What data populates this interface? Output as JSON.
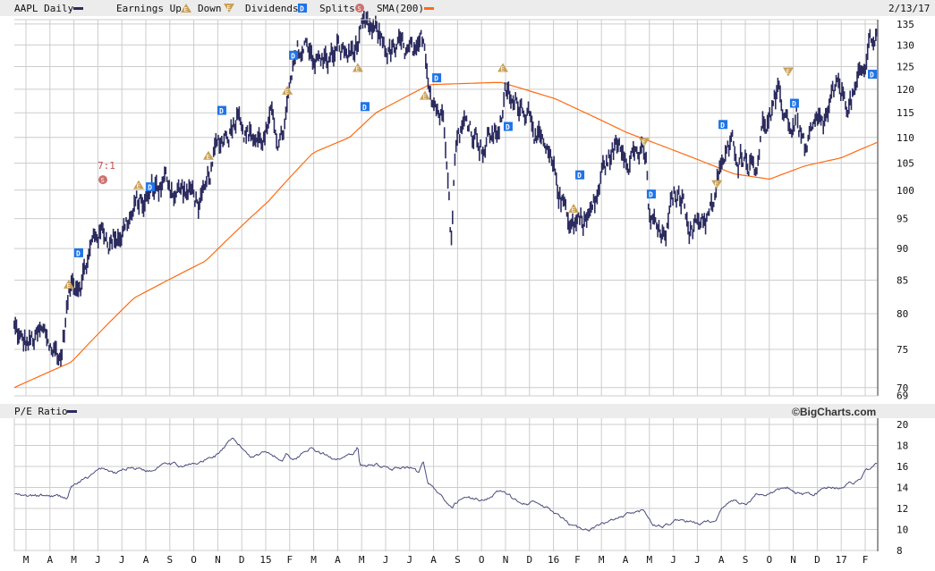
{
  "header": {
    "symbol_label": "AAPL Daily",
    "earnings_label": "Earnings Up",
    "down_label": "Down",
    "dividends_label": "Dividends",
    "splits_label": "Splits",
    "sma_label": "SMA(200)",
    "date": "2/13/17"
  },
  "lower_header": {
    "label": "P/E Ratio",
    "brand": "©BigCharts.com"
  },
  "colors": {
    "price": "#2b2b5e",
    "sma": "#ff6a10",
    "grid": "#cccccc",
    "header_bg": "#ececec",
    "earnings": "#c9a055",
    "dividend": "#1e73e8",
    "split": "#d07070"
  },
  "icons": {
    "earnings_up": "E",
    "earnings_down": "E",
    "dividend": "D",
    "split": "S"
  },
  "chart_data": [
    {
      "type": "line",
      "title": "AAPL Daily",
      "x_unit": "months since 2014-03-01",
      "scale": "log",
      "ylim": [
        69,
        135
      ],
      "yticks": [
        135,
        130,
        125,
        120,
        115,
        110,
        105,
        100,
        95,
        90,
        85,
        80,
        75,
        70,
        69
      ],
      "price": [
        [
          -0.49,
          78
        ],
        [
          -0.15,
          75
        ],
        [
          0.6,
          76
        ],
        [
          1.46,
          74
        ],
        [
          1.75,
          82
        ],
        [
          1.9,
          84
        ],
        [
          2.46,
          88
        ],
        [
          3.02,
          93
        ],
        [
          3.58,
          92
        ],
        [
          4.14,
          95
        ],
        [
          5.07,
          98
        ],
        [
          5.45,
          101
        ],
        [
          6.19,
          101
        ],
        [
          6.94,
          99
        ],
        [
          7.5,
          97
        ],
        [
          7.87,
          105
        ],
        [
          8.54,
          113
        ],
        [
          8.92,
          119
        ],
        [
          9.18,
          113
        ],
        [
          9.74,
          110
        ],
        [
          10.3,
          112
        ],
        [
          10.67,
          109
        ],
        [
          11.04,
          119
        ],
        [
          11.31,
          125
        ],
        [
          11.79,
          130
        ],
        [
          12.35,
          126
        ],
        [
          12.91,
          128
        ],
        [
          13.47,
          127
        ],
        [
          13.92,
          131
        ],
        [
          14.59,
          130
        ],
        [
          15.34,
          128
        ],
        [
          16.08,
          126
        ],
        [
          16.31,
          123
        ],
        [
          16.57,
          128
        ],
        [
          16.83,
          122
        ],
        [
          17.39,
          115
        ],
        [
          17.65,
          105
        ],
        [
          17.72,
          93
        ],
        [
          17.95,
          113
        ],
        [
          18.51,
          113
        ],
        [
          19.07,
          110
        ],
        [
          19.63,
          111
        ],
        [
          20.0,
          119
        ],
        [
          20.37,
          115
        ],
        [
          20.75,
          118
        ],
        [
          21.12,
          117
        ],
        [
          21.49,
          108
        ],
        [
          22.05,
          100
        ],
        [
          22.43,
          97
        ],
        [
          22.8,
          95
        ],
        [
          23.36,
          96
        ],
        [
          23.73,
          97
        ],
        [
          24.1,
          104
        ],
        [
          24.66,
          108
        ],
        [
          25.22,
          110
        ],
        [
          25.6,
          108
        ],
        [
          25.86,
          104
        ],
        [
          25.97,
          95
        ],
        [
          26.34,
          92
        ],
        [
          26.53,
          90
        ],
        [
          27.09,
          98
        ],
        [
          27.46,
          98
        ],
        [
          27.84,
          94
        ],
        [
          28.21,
          96
        ],
        [
          28.77,
          97
        ],
        [
          28.96,
          104
        ],
        [
          29.51,
          107
        ],
        [
          30.07,
          108
        ],
        [
          30.45,
          106
        ],
        [
          30.63,
          113
        ],
        [
          31.38,
          116
        ],
        [
          31.94,
          112
        ],
        [
          32.13,
          115
        ],
        [
          32.5,
          107
        ],
        [
          32.87,
          109
        ],
        [
          33.25,
          110
        ],
        [
          33.62,
          116
        ],
        [
          34.18,
          117
        ],
        [
          34.74,
          120
        ],
        [
          35.0,
          121
        ],
        [
          35.11,
          128
        ],
        [
          35.3,
          132
        ],
        [
          35.49,
          134
        ]
      ],
      "sma200": [
        [
          -0.49,
          70
        ],
        [
          1.9,
          73.3
        ],
        [
          4.51,
          82.3
        ],
        [
          7.5,
          88
        ],
        [
          10.11,
          98
        ],
        [
          11.98,
          107
        ],
        [
          13.5,
          110
        ],
        [
          14.59,
          115
        ],
        [
          16.83,
          121
        ],
        [
          19.81,
          121.5
        ],
        [
          22.05,
          118
        ],
        [
          25.04,
          111
        ],
        [
          27.28,
          107
        ],
        [
          29.51,
          103
        ],
        [
          31.01,
          102
        ],
        [
          32.5,
          104.5
        ],
        [
          33.99,
          106
        ],
        [
          35.49,
          109
        ]
      ],
      "events": [
        {
          "type": "earnings_up",
          "t": 1.79,
          "price": 84.4
        },
        {
          "type": "earnings_up",
          "t": 4.7,
          "price": 101
        },
        {
          "type": "earnings_up",
          "t": 7.61,
          "price": 106.5
        },
        {
          "type": "earnings_up",
          "t": 10.9,
          "price": 119.8
        },
        {
          "type": "earnings_up",
          "t": 13.84,
          "price": 124.8
        },
        {
          "type": "earnings_up",
          "t": 16.64,
          "price": 118.7
        },
        {
          "type": "earnings_up",
          "t": 19.89,
          "price": 124.8
        },
        {
          "type": "earnings_up",
          "t": 22.84,
          "price": 96.8
        },
        {
          "type": "earnings_down",
          "t": 25.78,
          "price": 109
        },
        {
          "type": "earnings_down",
          "t": 28.81,
          "price": 101
        },
        {
          "type": "earnings_down",
          "t": 31.79,
          "price": 123.8
        },
        {
          "type": "dividend",
          "t": 2.2,
          "price": 89.3
        },
        {
          "type": "dividend",
          "t": 5.19,
          "price": 100.6
        },
        {
          "type": "dividend",
          "t": 8.17,
          "price": 115.5
        },
        {
          "type": "dividend",
          "t": 11.16,
          "price": 127.6
        },
        {
          "type": "dividend",
          "t": 14.14,
          "price": 116.3
        },
        {
          "type": "dividend",
          "t": 17.13,
          "price": 122.5
        },
        {
          "type": "dividend",
          "t": 20.11,
          "price": 112.2
        },
        {
          "type": "dividend",
          "t": 23.1,
          "price": 102.8
        },
        {
          "type": "dividend",
          "t": 26.08,
          "price": 99.3
        },
        {
          "type": "dividend",
          "t": 29.07,
          "price": 112.6
        },
        {
          "type": "dividend",
          "t": 32.05,
          "price": 117
        },
        {
          "type": "dividend",
          "t": 35.3,
          "price": 123.3
        },
        {
          "type": "split",
          "t": 3.21,
          "price": 101.9,
          "label": "7:1"
        }
      ]
    },
    {
      "type": "line",
      "title": "P/E Ratio",
      "ylim": [
        8,
        20
      ],
      "yticks": [
        20,
        18,
        16,
        14,
        12,
        10,
        8
      ],
      "pe": [
        [
          -0.49,
          13.4
        ],
        [
          -0.07,
          13.1
        ],
        [
          1.16,
          13.2
        ],
        [
          1.72,
          13
        ],
        [
          1.9,
          14.1
        ],
        [
          2.65,
          15
        ],
        [
          3.21,
          15.8
        ],
        [
          3.77,
          15.3
        ],
        [
          4.33,
          16
        ],
        [
          5.26,
          15.6
        ],
        [
          5.82,
          16.6
        ],
        [
          6.38,
          16.1
        ],
        [
          7.13,
          16.2
        ],
        [
          7.87,
          17
        ],
        [
          8.62,
          18.5
        ],
        [
          9.37,
          17
        ],
        [
          10.11,
          17.5
        ],
        [
          10.67,
          16.5
        ],
        [
          10.86,
          17.3
        ],
        [
          11.23,
          16.7
        ],
        [
          11.79,
          17.8
        ],
        [
          12.72,
          16.8
        ],
        [
          13.66,
          17
        ],
        [
          13.84,
          17.8
        ],
        [
          13.92,
          15.9
        ],
        [
          14.59,
          16.2
        ],
        [
          15.34,
          15.8
        ],
        [
          16.08,
          15.7
        ],
        [
          16.38,
          15.2
        ],
        [
          16.57,
          16.2
        ],
        [
          16.75,
          14.5
        ],
        [
          17.2,
          13.5
        ],
        [
          17.76,
          12
        ],
        [
          18.13,
          13
        ],
        [
          19.07,
          12.8
        ],
        [
          19.81,
          13.7
        ],
        [
          20.37,
          12.8
        ],
        [
          21.31,
          12.5
        ],
        [
          22.05,
          11.5
        ],
        [
          22.61,
          10.5
        ],
        [
          23.17,
          10
        ],
        [
          23.73,
          10.2
        ],
        [
          24.66,
          11
        ],
        [
          25.41,
          11.5
        ],
        [
          25.78,
          11.8
        ],
        [
          26.16,
          10.5
        ],
        [
          26.53,
          10.2
        ],
        [
          27.28,
          11
        ],
        [
          28.02,
          10.5
        ],
        [
          28.77,
          10.8
        ],
        [
          28.96,
          12
        ],
        [
          29.51,
          12.8
        ],
        [
          30.07,
          12.4
        ],
        [
          30.45,
          13.4
        ],
        [
          31.01,
          13.4
        ],
        [
          31.75,
          14
        ],
        [
          32.13,
          13.3
        ],
        [
          32.87,
          13.4
        ],
        [
          33.43,
          14
        ],
        [
          33.99,
          14.1
        ],
        [
          34.74,
          14.7
        ],
        [
          35.0,
          15.5
        ],
        [
          35.49,
          16.1
        ]
      ]
    }
  ],
  "x_axis": {
    "labels": [
      "M",
      "A",
      "M",
      "J",
      "J",
      "A",
      "S",
      "O",
      "N",
      "D",
      "15",
      "F",
      "M",
      "A",
      "M",
      "J",
      "J",
      "A",
      "S",
      "O",
      "N",
      "D",
      "16",
      "F",
      "M",
      "A",
      "M",
      "J",
      "J",
      "A",
      "S",
      "O",
      "N",
      "D",
      "17",
      "F"
    ]
  }
}
